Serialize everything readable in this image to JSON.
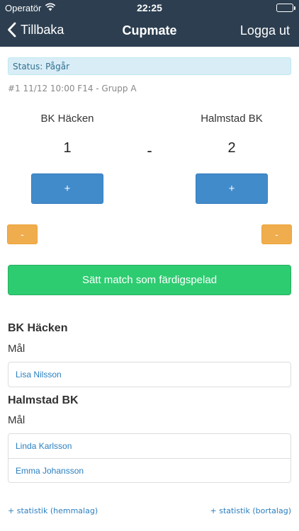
{
  "statusbar": {
    "carrier": "Operatör",
    "time": "22:25",
    "wifi_icon": "wifi-icon",
    "battery_icon": "battery-icon",
    "battery_level": 1.0
  },
  "navbar": {
    "back_label": "Tillbaka",
    "title": "Cupmate",
    "logout_label": "Logga ut"
  },
  "match": {
    "status": "Status: Pågår",
    "info": "#1 11/12 10:00 F14 - Grupp A",
    "home_team": "BK Häcken",
    "away_team": "Halmstad BK",
    "home_score": "1",
    "away_score": "2",
    "separator": "-",
    "plus_label": "+",
    "minus_label": "-",
    "finish_label": "Sätt match som färdigspelad"
  },
  "goals": {
    "home": {
      "team": "BK Häcken",
      "label": "Mål",
      "scorers": [
        "Lisa Nilsson"
      ]
    },
    "away": {
      "team": "Halmstad BK",
      "label": "Mål",
      "scorers": [
        "Linda Karlsson",
        "Emma Johansson"
      ]
    }
  },
  "stats": {
    "home_link": "+ statistik (hemmalag)",
    "away_link": "+ statistik (bortalag)"
  },
  "colors": {
    "navbar": "#2c3e50",
    "primary": "#428bca",
    "warning": "#f0ad4e",
    "success": "#2ecc71",
    "link": "#2a7fc0",
    "info_bg": "#d9edf7"
  }
}
